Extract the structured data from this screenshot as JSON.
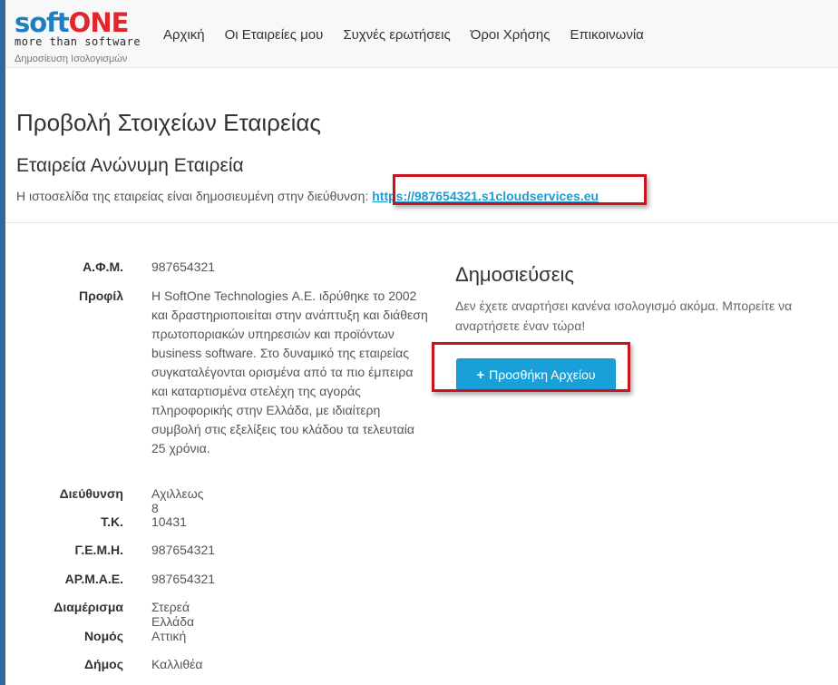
{
  "logo": {
    "word_soft": "soft",
    "word_one": "ONE",
    "tagline": "more than software",
    "subtitle": "Δημοσίευση Ισολογισμών"
  },
  "nav": [
    {
      "label": "Αρχική"
    },
    {
      "label": "Οι Εταιρείες μου"
    },
    {
      "label": "Συχνές ερωτήσεις"
    },
    {
      "label": "Όροι Χρήσης"
    },
    {
      "label": "Επικοινωνία"
    }
  ],
  "page": {
    "title": "Προβολή Στοιχείων Εταιρείας",
    "company_title": "Εταιρεία Ανώνυμη Εταιρεία",
    "published_text": "Η ιστοσελίδα της εταιρείας είναι δημοσιευμένη στην διεύθυνση:",
    "published_url": "https://987654321.s1cloudservices.eu"
  },
  "details": [
    {
      "label": "Α.Φ.Μ.",
      "value": "987654321"
    },
    {
      "label": "Προφίλ",
      "value": "Η SoftOne Technologies Α.Ε. ιδρύθηκε το 2002 και δραστηριοποιείται στην ανάπτυξη και διάθεση πρωτοποριακών υπηρεσιών και προϊόντων business software. Στο δυναμικό της εταιρείας συγκαταλέγονται ορισμένα από τα πιο έμπειρα και καταρτισμένα στελέχη της αγοράς πληροφορικής στην Ελλάδα, με ιδιαίτερη συμβολή στις εξελίξεις του κλάδου τα τελευταία 25 χρόνια."
    },
    {
      "label": "Διεύθυνση",
      "value": "Αχιλλεως 8"
    },
    {
      "label": "Τ.Κ.",
      "value": "10431"
    },
    {
      "label": "Γ.Ε.Μ.Η.",
      "value": "987654321"
    },
    {
      "label": "ΑΡ.Μ.Α.Ε.",
      "value": "987654321"
    },
    {
      "label": "Διαμέρισμα",
      "value": "Στερεά Ελλάδα"
    },
    {
      "label": "Νομός",
      "value": "Αττική"
    },
    {
      "label": "Δήμος",
      "value": "Καλλιθέα"
    }
  ],
  "publications": {
    "title": "Δημοσιεύσεις",
    "empty_text": "Δεν έχετε αναρτήσει κανένα ισολογισμό ακόμα. Μπορείτε να αναρτήσετε έναν τώρα!",
    "add_button_icon": "+",
    "add_button_label": "Προσθήκη Αρχείου"
  },
  "colors": {
    "accent": "#1aa0d8",
    "highlight": "#c8141e",
    "brand_blue": "#1f7fbf",
    "brand_red": "#e3262d"
  }
}
